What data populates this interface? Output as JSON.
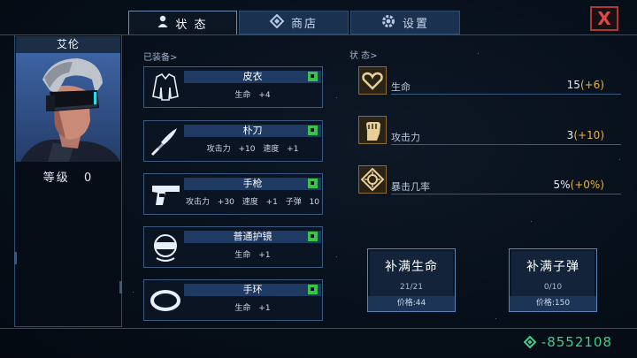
{
  "tabs": [
    {
      "label": "状 态",
      "icon": "person-icon",
      "active": true
    },
    {
      "label": "商店",
      "icon": "diamond-icon",
      "active": false
    },
    {
      "label": "设置",
      "icon": "gear-icon",
      "active": false
    }
  ],
  "close_label": "X",
  "character": {
    "name": "艾伦",
    "level_label": "等级",
    "level_value": "0"
  },
  "equipped_label": "已装备>",
  "status_label": "状 态>",
  "equipment": [
    {
      "name": "皮衣",
      "icon": "jacket-icon",
      "stats": "生命 +4"
    },
    {
      "name": "朴刀",
      "icon": "blade-icon",
      "stats": "攻击力 +10 速度 +1"
    },
    {
      "name": "手枪",
      "icon": "pistol-icon",
      "stats": "攻击力 +30 速度 +1 子弹 10"
    },
    {
      "name": "普通护镜",
      "icon": "goggles-icon",
      "stats": "生命 +1"
    },
    {
      "name": "手环",
      "icon": "bracelet-icon",
      "stats": "生命 +1"
    }
  ],
  "attributes": [
    {
      "name": "生命",
      "icon": "heart-icon",
      "value": "15",
      "bonus": "(+6)"
    },
    {
      "name": "攻击力",
      "icon": "fist-icon",
      "value": "3",
      "bonus": "(+10)"
    },
    {
      "name": "暴击几率",
      "icon": "crosshair-icon",
      "value": "5%",
      "bonus": "(+0%)"
    }
  ],
  "refill": [
    {
      "title": "补满生命",
      "count": "21/21",
      "price": "价格:44"
    },
    {
      "title": "补满子弹",
      "count": "0/10",
      "price": "价格:150"
    }
  ],
  "currency": {
    "icon": "gem-icon",
    "value": "-8552108"
  }
}
